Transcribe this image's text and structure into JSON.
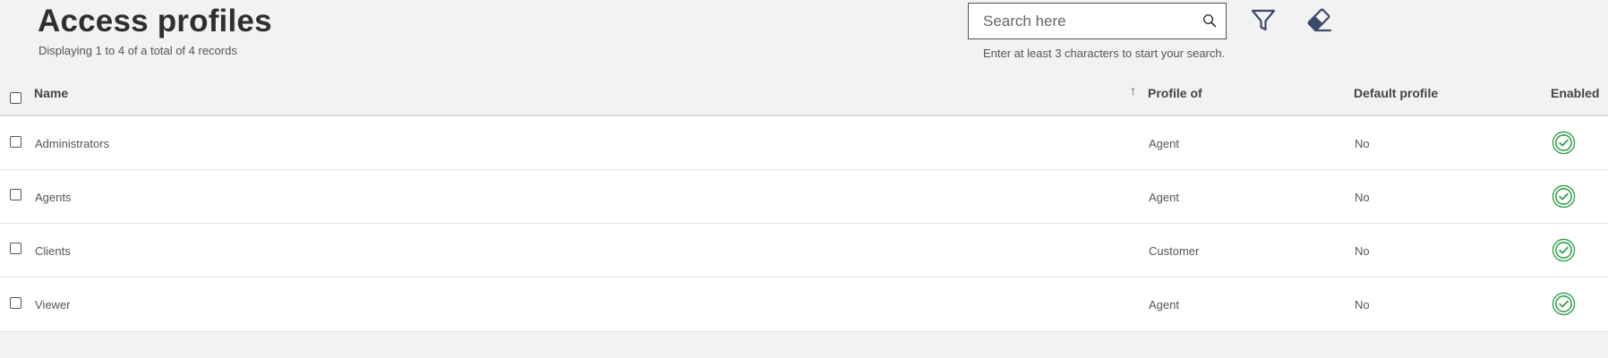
{
  "header": {
    "title": "Access profiles",
    "records_info": "Displaying 1 to 4 of a total of 4 records"
  },
  "search": {
    "placeholder": "Search here",
    "value": "",
    "hint": "Enter at least 3 characters to start your search."
  },
  "table": {
    "columns": [
      "Name",
      "Profile of",
      "Default profile",
      "Enabled"
    ],
    "sort": {
      "column": "Profile of",
      "direction": "ascending"
    },
    "rows": [
      {
        "name": "Administrators",
        "profile_of": "Agent",
        "default_profile": "No",
        "enabled": true
      },
      {
        "name": "Agents",
        "profile_of": "Agent",
        "default_profile": "No",
        "enabled": true
      },
      {
        "name": "Clients",
        "profile_of": "Customer",
        "default_profile": "No",
        "enabled": true
      },
      {
        "name": "Viewer",
        "profile_of": "Agent",
        "default_profile": "No",
        "enabled": true
      }
    ]
  },
  "icons": {
    "search": "search-icon",
    "filter": "filter-icon",
    "clear": "eraser-icon",
    "enabled": "check-circle-icon",
    "sort": "arrow-up-icon"
  },
  "colors": {
    "enabled_green": "#2e9e47",
    "icon_navy": "#3b4a6b",
    "background": "#f2f2f2"
  }
}
